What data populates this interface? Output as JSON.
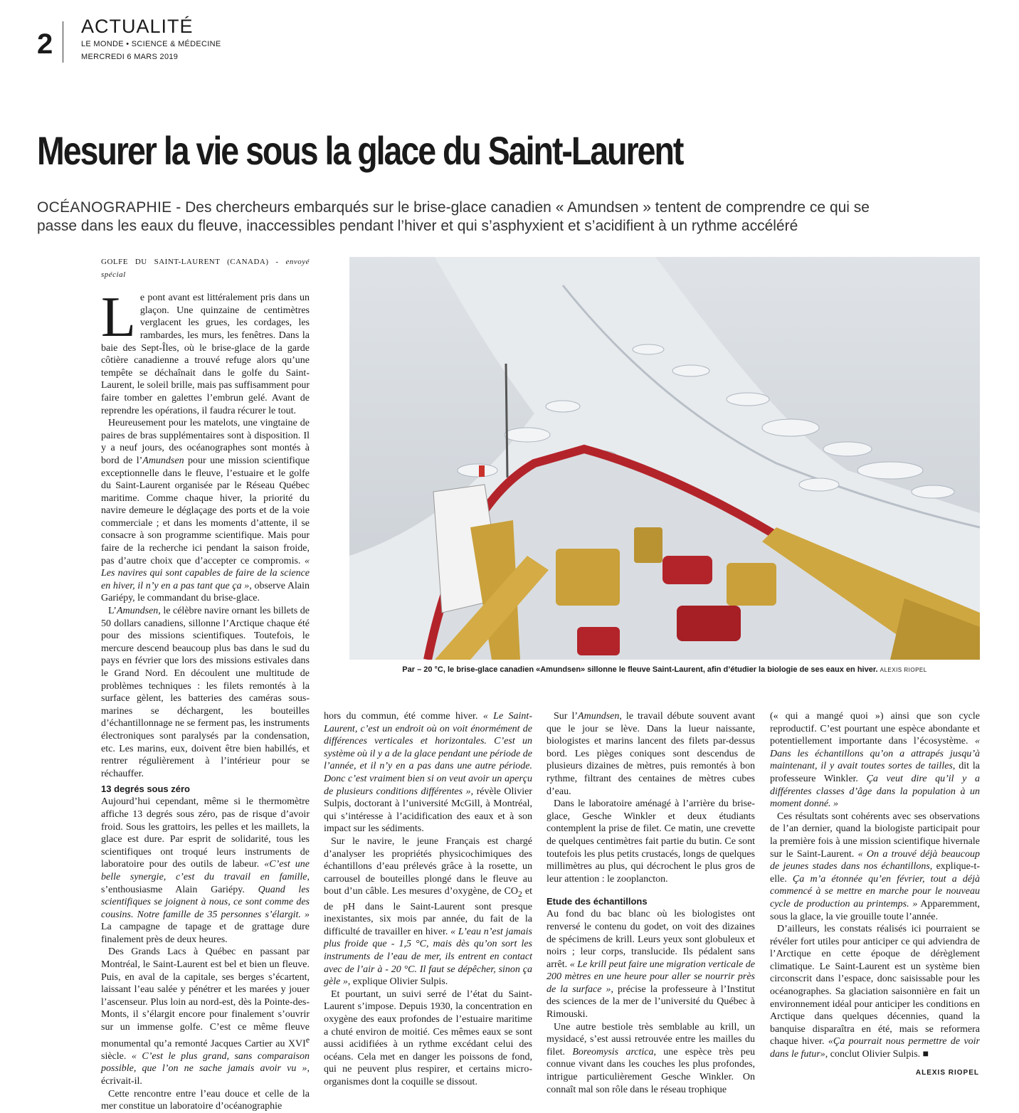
{
  "header": {
    "page_number": "2",
    "rubric": "ACTUALITÉ",
    "section": "LE MONDE • SCIENCE & MÉDECINE",
    "date": "MERCREDI 6 MARS 2019"
  },
  "article": {
    "headline": "Mesurer la vie sous la glace du Saint-Laurent",
    "standfirst_rubric": "OCÉANOGRAPHIE",
    "standfirst": " - Des chercheurs embarqués sur le brise-glace canadien « Amundsen » tentent de comprendre ce qui se passe dans les eaux du fleuve, inaccessibles pendant l’hiver et qui s’asphyxient et s’acidifient à un rythme accéléré",
    "dateline_place": "GOLFE DU SAINT-LAURENT (CANADA)",
    "dateline_role": " - envoyé spécial",
    "dropcap": "L",
    "c1_p1": "e pont avant est littéralement pris dans un glaçon. Une quinzaine de centimètres verglacent les grues, les cordages, les rambardes, les murs, les fenêtres. Dans la baie des Sept-Îles, où le brise-glace de la garde côtière canadienne a trouvé refuge alors qu’une tempête se déchaînait dans le golfe du Saint-Laurent, le soleil brille, mais pas suffisamment pour faire tomber en galettes l’embrun gelé. Avant de reprendre les opérations, il faudra récurer le tout.",
    "c1_p2a": "Heureusement pour les matelots, une vingtaine de paires de bras supplémentaires sont à disposition. Il y a neuf jours, des océanographes sont montés à bord de l’",
    "c1_p2_ship": "Amundsen",
    "c1_p2b": " pour une mission scientifique exceptionnelle dans le fleuve, l’estuaire et le golfe du Saint-Laurent organisée par le Réseau Québec maritime. Comme chaque hiver, la priorité du navire demeure le déglaçage des ports et de la voie commerciale ; et dans les moments d’attente, il se consacre à son programme scientifique. Mais pour faire de la recherche ici pendant la saison froide, pas d’autre choix que d’accepter ce compromis. ",
    "c1_p2_quote": "« Les navires qui sont capables de faire de la science en hiver, il n’y en a pas tant que ça »",
    "c1_p2c": ", observe Alain Gariépy, le commandant du brise-glace.",
    "c1_p3a": "L’",
    "c1_p3_ship": "Amundsen",
    "c1_p3b": ", le célèbre navire ornant les billets de 50 dollars canadiens, sillonne l’Arctique chaque été pour des missions scientifiques. Toutefois, le mercure descend beaucoup plus bas dans le sud du pays en février que lors des missions estivales dans le Grand Nord. En découlent une multitude de problèmes techniques : les filets remontés à la surface gèlent, les batteries des caméras sous-marines se déchargent, les bouteilles d’échantillonnage ne se ferment pas, les instruments électroniques sont paralysés par la condensation, etc. Les marins, eux, doivent être bien habillés, et rentrer régulièrement à l’intérieur pour se réchauffer.",
    "c1_sub": "13 degrés sous zéro",
    "c1_p4a": "Aujourd’hui cependant, même si le thermomètre affiche 13 degrés sous zéro, pas de risque d’avoir froid. Sous les grattoirs, les pelles et les maillets, la glace est dure. Par esprit de solidarité, tous les scientifiques ont troqué leurs instruments de laboratoire pour des outils de labeur. ",
    "c1_p4_q1": "«C’est une belle synergie, c’est du travail en famille",
    "c1_p4b": ", s’enthousiasme Alain Gariépy. ",
    "c1_p4_q2": "Quand les scientifiques se joignent à nous, ce sont comme des cousins. Notre famille de 35 personnes s’élargit. »",
    "c1_p4c": " La campagne de tapage et de grattage dure finalement près de deux heures.",
    "c1_p5a": "Des Grands Lacs à Québec en passant par Montréal, le Saint-Laurent est bel et bien un fleuve. Puis, en aval de la capitale, ses berges s’écartent, laissant l’eau salée y pénétrer et les marées y jouer l’ascenseur. Plus loin au nord-est, dès la Pointe-des-Monts, il s’élargit encore pour finalement s’ouvrir sur un immense golfe. C’est ce même fleuve monumental qu’a remonté Jacques Cartier au XVI",
    "c1_p5_sup": "e",
    "c1_p5b": " siècle. ",
    "c1_p5_quote": "« C’est le plus grand, sans comparaison possible, que l’on ne sache jamais avoir vu »",
    "c1_p5c": ", écrivait-il.",
    "c1_p6": "Cette rencontre entre l’eau douce et celle de la mer constitue un laboratoire d’océanographie",
    "c2_p1a": "hors du commun, été comme hiver. ",
    "c2_p1_quote": "« Le Saint-Laurent, c’est un endroit où on voit énormément de différences verticales et horizontales. C’est un système où il y a de la glace pendant une période de l’année, et il n’y en a pas dans une autre période. Donc c’est vraiment bien si on veut avoir un aperçu de plusieurs conditions différentes »",
    "c2_p1b": ", révèle Olivier Sulpis, doctorant à l’université McGill, à Montréal, qui s’intéresse à l’acidification des eaux et à son impact sur les sédiments.",
    "c2_p2a": "Sur le navire, le jeune Français est chargé d’analyser les propriétés physicochimiques des échantillons d’eau prélevés grâce à la rosette, un carrousel de bouteilles plongé dans le fleuve au bout d’un câble. Les mesures d’oxygène, de CO",
    "c2_p2_sub": "2",
    "c2_p2b": " et de pH dans le Saint-Laurent sont presque inexistantes, six mois par année, du fait de la difficulté de travailler en hiver. ",
    "c2_p2_quote": "« L’eau n’est jamais plus froide que - 1,5 °C, mais dès qu’on sort les instruments de l’eau de mer, ils entrent en contact avec de l’air à - 20 °C. Il faut se dépêcher, sinon ça gèle »",
    "c2_p2c": ", explique Olivier Sulpis.",
    "c2_p3": "Et pourtant, un suivi serré de l’état du Saint-Laurent s’impose. Depuis 1930, la concentration en oxygène des eaux profondes de l’estuaire maritime a chuté environ de moitié. Ces mêmes eaux se sont aussi acidifiées à un rythme excédant celui des océans. Cela met en danger les poissons de fond, qui ne peuvent plus respirer, et certains micro-organismes dont la coquille se dissout.",
    "c3_p1a": "Sur l’",
    "c3_p1_ship": "Amundsen",
    "c3_p1b": ", le travail débute souvent avant que le jour se lève. Dans la lueur naissante, biologistes et marins lancent des filets par-dessus bord. Les pièges coniques sont descendus de plusieurs dizaines de mètres, puis remontés à bon rythme, filtrant des centaines de mètres cubes d’eau.",
    "c3_p2": "Dans le laboratoire aménagé à l’arrière du brise-glace, Gesche Winkler et deux étudiants contemplent la prise de filet. Ce matin, une crevette de quelques centimètres fait partie du butin. Ce sont toutefois les plus petits crustacés, longs de quelques millimètres au plus, qui décrochent le plus gros de leur attention : le zooplancton.",
    "c3_sub": "Etude des échantillons",
    "c3_p3a": "Au fond du bac blanc où les biologistes ont renversé le contenu du godet, on voit des dizaines de spécimens de krill. Leurs yeux sont globuleux et noirs ; leur corps, translucide. Ils pédalent sans arrêt. ",
    "c3_p3_quote": "« Le krill peut faire une migration verticale de 200 mètres en une heure pour aller se nourrir près de la surface »",
    "c3_p3b": ", précise la professeure à l’Institut des sciences de la mer de l’université du Québec à Rimouski.",
    "c3_p4a": "Une autre bestiole très semblable au krill, un mysidacé, s’est aussi retrouvée entre les mailles du filet. ",
    "c3_p4_species": "Boreomysis arctica",
    "c3_p4b": ", une espèce très peu connue vivant dans les couches les plus profondes, intrigue particulièrement Gesche Winkler. On connaît mal son rôle dans le réseau trophique",
    "c4_p1a": "(« qui a mangé quoi ») ainsi que son cycle reproductif. C’est pourtant une espèce abondante et potentiellement importante dans l’écosystème. ",
    "c4_p1_q1": "« Dans les échantillons qu’on a attrapés jusqu’à maintenant, il y avait toutes sortes de tailles",
    "c4_p1b": ", dit la professeure Winkler. ",
    "c4_p1_q2": "Ça veut dire qu’il y a différentes classes d’âge dans la population à un moment donné. »",
    "c4_p2a": "Ces résultats sont cohérents avec ses observations de l’an dernier, quand la biologiste participait pour la première fois à une mission scientifique hivernale sur le Saint-Laurent. ",
    "c4_p2_q1": "« On a trouvé déjà beaucoup de jeunes stades dans nos échantillons",
    "c4_p2b": ", explique-t-elle. ",
    "c4_p2_q2": "Ça m’a étonnée qu’en février, tout a déjà commencé à se mettre en marche pour le nouveau cycle de production au printemps. »",
    "c4_p2c": " Apparemment, sous la glace, la vie grouille toute l’année.",
    "c4_p3a": "D’ailleurs, les constats réalisés ici pourraient se révéler fort utiles pour anticiper ce qui adviendra de l’Arctique en cette époque de dérèglement climatique. Le Saint-Laurent est un système bien circonscrit dans l’espace, donc saisissable pour les océanographes. Sa glaciation saisonnière en fait un environnement idéal pour anticiper les conditions en Arctique dans quelques décennies, quand la banquise disparaîtra en été, mais se reformera chaque hiver. ",
    "c4_p3_quote": "«Ça pourrait nous permettre de voir dans le futur»",
    "c4_p3b": ", conclut Olivier Sulpis. ",
    "end_mark": "■",
    "byline": "ALEXIS RIOPEL"
  },
  "photo": {
    "caption": "Par – 20 °C, le brise-glace canadien «Amundsen» sillonne le fleuve Saint-Laurent, afin d’étudier la biologie de ses eaux en hiver. ",
    "credit": "ALEXIS RIOPEL"
  },
  "colors": {
    "hull_red": "#b3242a",
    "crane_yellow": "#c9a03a",
    "ice": "#e9ecef"
  }
}
